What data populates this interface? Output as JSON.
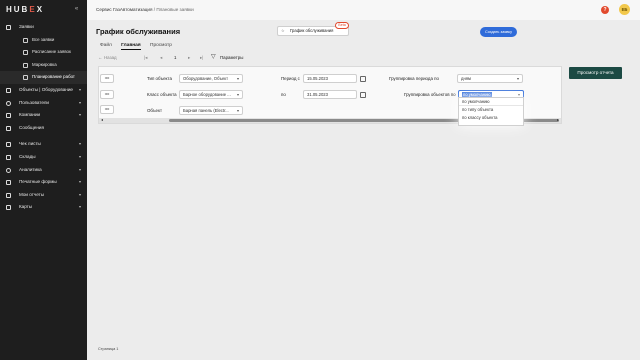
{
  "app": {
    "logo_pre": "HUB",
    "logo_x": "E",
    "logo_post": "X",
    "collapse_icon": "«"
  },
  "sidebar": {
    "items": [
      {
        "label": "Заявки",
        "icon": "requests-icon",
        "expanded": true
      },
      {
        "label": "Все заявки",
        "sub": true
      },
      {
        "label": "Расписание заявок",
        "sub": true
      },
      {
        "label": "Маркировка",
        "sub": true
      },
      {
        "label": "Планирование работ",
        "sub": true,
        "active": true
      },
      {
        "label": "Объекты | Оборудование",
        "icon": "objects-icon",
        "chevron": "▾"
      },
      {
        "label": "Пользователи",
        "icon": "users-icon",
        "chevron": "▾"
      },
      {
        "label": "Компании",
        "icon": "companies-icon",
        "chevron": "▾"
      },
      {
        "label": "Сообщения",
        "icon": "messages-icon"
      },
      {
        "label": "Чек листы",
        "icon": "checklist-icon",
        "chevron": "▾"
      },
      {
        "label": "Склады",
        "icon": "warehouse-icon",
        "chevron": "▾"
      },
      {
        "label": "Аналитика",
        "icon": "analytics-icon",
        "chevron": "▾"
      },
      {
        "label": "Печатные формы",
        "icon": "print-icon",
        "chevron": "▾"
      },
      {
        "label": "Мои отчеты",
        "icon": "reports-icon",
        "chevron": "▾"
      },
      {
        "label": "Карты",
        "icon": "map-icon",
        "chevron": "▾"
      }
    ]
  },
  "header": {
    "breadcrumb_main": "Сервис ГазАвтоматизация",
    "breadcrumb_sep": " / ",
    "breadcrumb_current": "Плановые заявки",
    "help": "?",
    "avatar_initials": "ЕБ"
  },
  "page": {
    "title": "График обслуживания",
    "favorite_label": "График обслуживания",
    "favorite_icon": "☆",
    "beta_badge": "Beta",
    "create_button": "Создать заявку",
    "tabs": [
      "Файл",
      "Главная",
      "Просмотр"
    ],
    "active_tab": "Главная"
  },
  "toolbar": {
    "back": "←",
    "back_label": "Назад",
    "first": "|◂",
    "prev": "◂",
    "page": "1",
    "next": "▸",
    "last": "▸|",
    "params_label": "Параметры"
  },
  "report": {
    "expander": "◂ ▸",
    "object_type_label": "Тип объекта",
    "object_type_value": "Оборудование, Объект",
    "object_class_label": "Класс объекта",
    "object_class_value": "Барное оборудование ...",
    "object_label": "Объект",
    "object_value": "Барная панель (Electr...",
    "period_from_label": "Период с",
    "period_from_value": "15.05.2023",
    "period_to_label": "по",
    "period_to_value": "31.05.2023",
    "period_group_label": "Группировка периода по",
    "period_group_value": "дням",
    "object_group_label": "Группировка объектов по",
    "object_group_value": "по умолчанию",
    "object_group_options": [
      "по умолчанию",
      "по типу объекта",
      "по классу объекта"
    ],
    "view_report_button": "Просмотр отчета",
    "scroll_left": "◂",
    "scroll_right": "▸"
  },
  "status": {
    "page_label": "Страница 1"
  }
}
